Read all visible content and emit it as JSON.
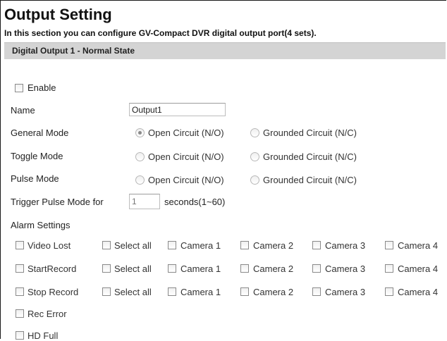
{
  "page": {
    "title": "Output Setting",
    "subtitle": "In this section you can configure GV-Compact DVR digital output port(4 sets).",
    "section_header": "Digital Output 1 - Normal State"
  },
  "form": {
    "enable_label": "Enable",
    "name_label": "Name",
    "name_value": "Output1",
    "modes": [
      {
        "label": "General Mode",
        "open": "Open Circuit (N/O)",
        "grounded": "Grounded Circuit (N/C)",
        "selected": "open"
      },
      {
        "label": "Toggle Mode",
        "open": "Open Circuit (N/O)",
        "grounded": "Grounded Circuit (N/C)",
        "selected": ""
      },
      {
        "label": "Pulse Mode",
        "open": "Open Circuit (N/O)",
        "grounded": "Grounded Circuit (N/C)",
        "selected": ""
      }
    ],
    "trigger_label": "Trigger Pulse Mode for",
    "trigger_value": "1",
    "trigger_suffix": "seconds(1~60)",
    "alarm_settings_label": "Alarm Settings",
    "alarm_rows": [
      {
        "label": "Video Lost",
        "select_all": "Select all",
        "cameras": [
          "Camera 1",
          "Camera 2",
          "Camera 3",
          "Camera 4"
        ]
      },
      {
        "label": "StartRecord",
        "select_all": "Select all",
        "cameras": [
          "Camera 1",
          "Camera 2",
          "Camera 3",
          "Camera 4"
        ]
      },
      {
        "label": "Stop Record",
        "select_all": "Select all",
        "cameras": [
          "Camera 1",
          "Camera 2",
          "Camera 3",
          "Camera 4"
        ]
      }
    ],
    "extra_alarms": [
      "Rec Error",
      "HD Full"
    ]
  }
}
